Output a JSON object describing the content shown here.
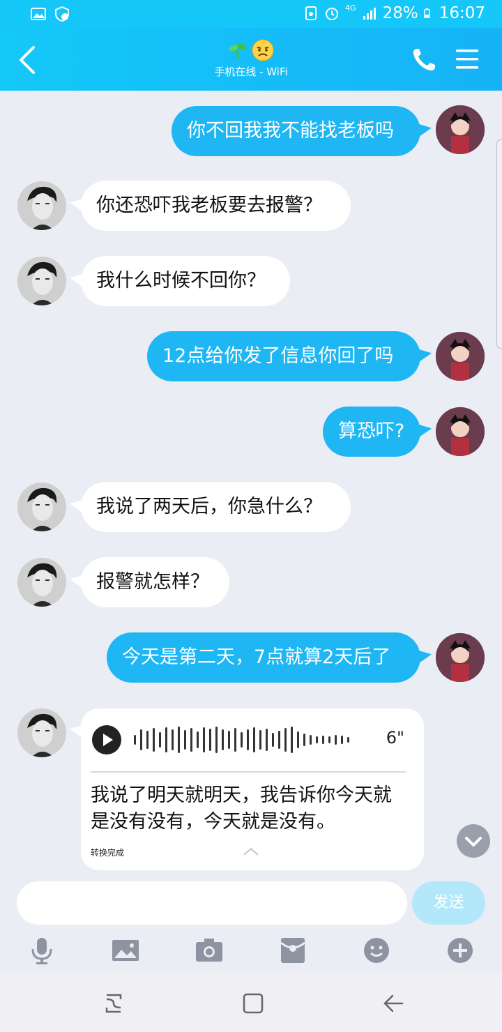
{
  "status_bar": {
    "network": "4G",
    "battery": "28%",
    "time": "16:07",
    "icons": [
      "gallery-icon",
      "shield-check-icon",
      "recycle-icon",
      "alarm-icon",
      "signal-icon",
      "battery-icon"
    ]
  },
  "header": {
    "subtitle": "手机在线 - WiFi",
    "icons": [
      "back-icon",
      "sprout-icon",
      "sick-face-icon",
      "phone-icon",
      "menu-icon"
    ]
  },
  "messages": [
    {
      "from": "me",
      "text": "你不回我我不能找老板吗"
    },
    {
      "from": "them",
      "text": "你还恐吓我老板要去报警？"
    },
    {
      "from": "them",
      "text": "我什么时候不回你？"
    },
    {
      "from": "me",
      "text": "12点给你发了信息你回了吗"
    },
    {
      "from": "me",
      "text": "算恐吓?"
    },
    {
      "from": "them",
      "text": "我说了两天后，你急什么？"
    },
    {
      "from": "them",
      "text": "报警就怎样？"
    },
    {
      "from": "me",
      "text": "今天是第二天，7点就算2天后了"
    }
  ],
  "voice_message": {
    "duration": "6\"",
    "transcript": "我说了明天就明天，我告诉你今天就是没有没有，今天就是没有。",
    "status": "转换完成"
  },
  "composer": {
    "send_label": "发送",
    "input_value": "",
    "toolbar": [
      "microphone-icon",
      "image-icon",
      "camera-icon",
      "red-packet-icon",
      "emoji-icon",
      "plus-icon"
    ]
  },
  "navbar": {
    "buttons": [
      "recent-apps-icon",
      "home-icon",
      "back-nav-icon"
    ]
  },
  "colors": {
    "accent": "#1fb6f4",
    "header_bg": "#14c8f8",
    "chat_bg": "#eaedf4"
  }
}
